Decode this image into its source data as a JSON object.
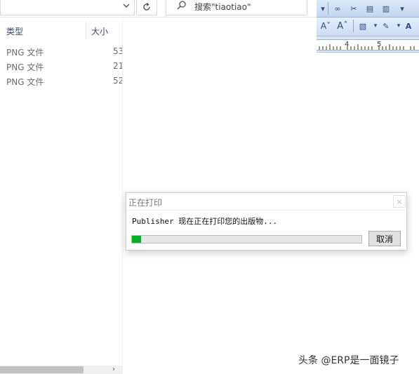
{
  "explorer": {
    "search_placeholder": "搜索\"tiaotiao\"",
    "columns": {
      "type": "类型",
      "size": "大小"
    },
    "rows": [
      {
        "type": "PNG 文件",
        "size": "53"
      },
      {
        "type": "PNG 文件",
        "size": "21"
      },
      {
        "type": "PNG 文件",
        "size": "52"
      }
    ]
  },
  "publisher": {
    "ruler_numbers": [
      "4",
      "5"
    ]
  },
  "dialog": {
    "title": "正在打印",
    "close_glyph": "×",
    "message": "Publisher 现在正在打印您的出版物...",
    "progress_percent": 4,
    "progress_color": "#06b025",
    "cancel_label": "取消"
  },
  "watermark": "头条 @ERP是一面镜子"
}
